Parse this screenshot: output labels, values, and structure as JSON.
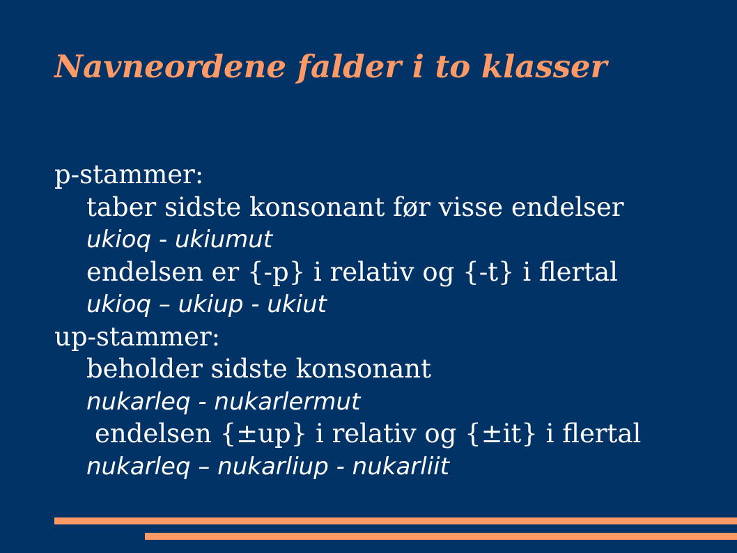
{
  "slide": {
    "title": "Navneordene falder i to klasser",
    "lines": [
      "p-stammer:",
      "taber sidste konsonant før visse endelser",
      "ukioq - ukiumut",
      "endelsen er {-p} i relativ og {-t} i flertal",
      "ukioq – ukiup - ukiut",
      "up-stammer:",
      "beholder sidste konsonant",
      "nukarleq - nukarlermut",
      "endelsen {±up} i relativ og {±it} i flertal",
      "nukarleq – nukarliup - nukarliit"
    ]
  },
  "colors": {
    "background": "#023366",
    "accent": "#FF9966",
    "text": "#FFFFFF"
  }
}
